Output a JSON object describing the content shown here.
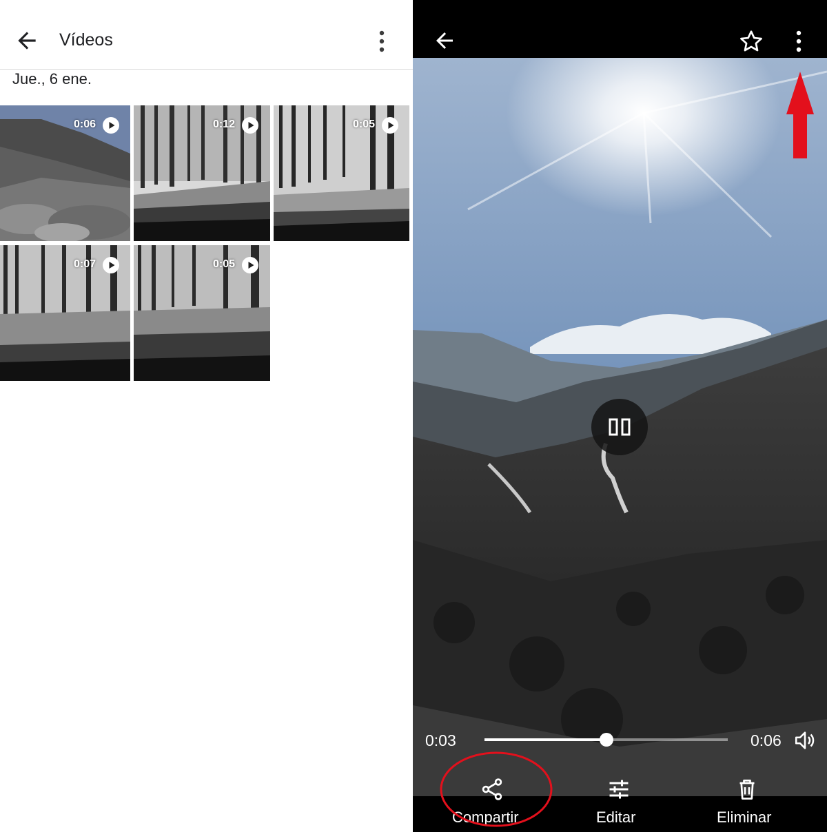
{
  "left": {
    "title": "Vídeos",
    "date_label": "Jue., 6 ene.",
    "videos": [
      {
        "duration": "0:06",
        "scene": "mountain-road"
      },
      {
        "duration": "0:12",
        "scene": "forest-road"
      },
      {
        "duration": "0:05",
        "scene": "forest-road"
      },
      {
        "duration": "0:07",
        "scene": "forest-road"
      },
      {
        "duration": "0:05",
        "scene": "forest-road"
      }
    ]
  },
  "right": {
    "current_time": "0:03",
    "total_time": "0:06",
    "progress": 0.5,
    "actions": {
      "share": "Compartir",
      "edit": "Editar",
      "delete": "Eliminar"
    }
  },
  "icons": [
    "back-arrow-icon",
    "more-vert-icon",
    "star-outline-icon",
    "play-icon",
    "pause-icon",
    "volume-icon",
    "share-icon",
    "edit-sliders-icon",
    "trash-icon"
  ],
  "colors": {
    "annotation_red": "#e3101c",
    "text_dark": "#202124",
    "divider": "#d9d9d9"
  }
}
